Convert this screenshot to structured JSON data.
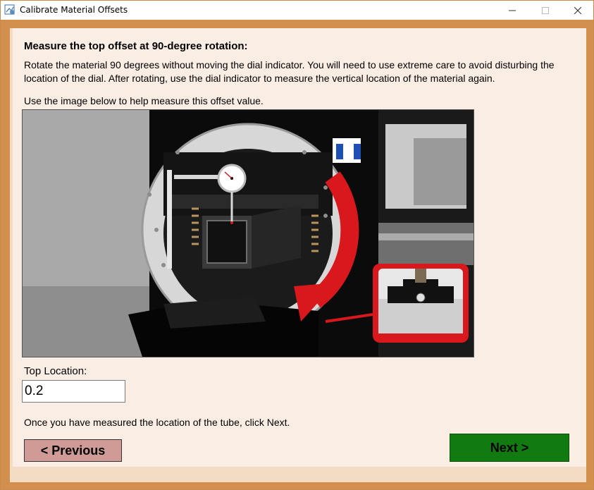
{
  "window": {
    "title": "Calibrate Material Offsets",
    "minimize_glyph": "—",
    "maximize_glyph": "☐",
    "close_glyph": "✕"
  },
  "content": {
    "heading": "Measure the top offset at 90-degree rotation:",
    "paragraph": "Rotate the material 90 degrees without moving the dial indicator. You will need to use extreme care to avoid disturbing the location of the dial. After rotating, use the dial indicator to measure the vertical location of the material again.",
    "image_hint": "Use the image below to help measure this offset value.",
    "field_label": "Top Location:",
    "field_value": "0.2",
    "footer_note": "Once you have measured the location of the tube, click Next."
  },
  "buttons": {
    "previous": "< Previous",
    "next": "Next >"
  },
  "colors": {
    "window_frame": "#d38f4d",
    "panel_background": "#faeee4",
    "previous_button": "#d09a97",
    "next_button": "#117b12",
    "arrow_red": "#d9181d"
  },
  "icons": {
    "app": "calibration-app-icon",
    "minimize": "minimize-icon",
    "maximize": "maximize-icon",
    "close": "close-icon"
  }
}
